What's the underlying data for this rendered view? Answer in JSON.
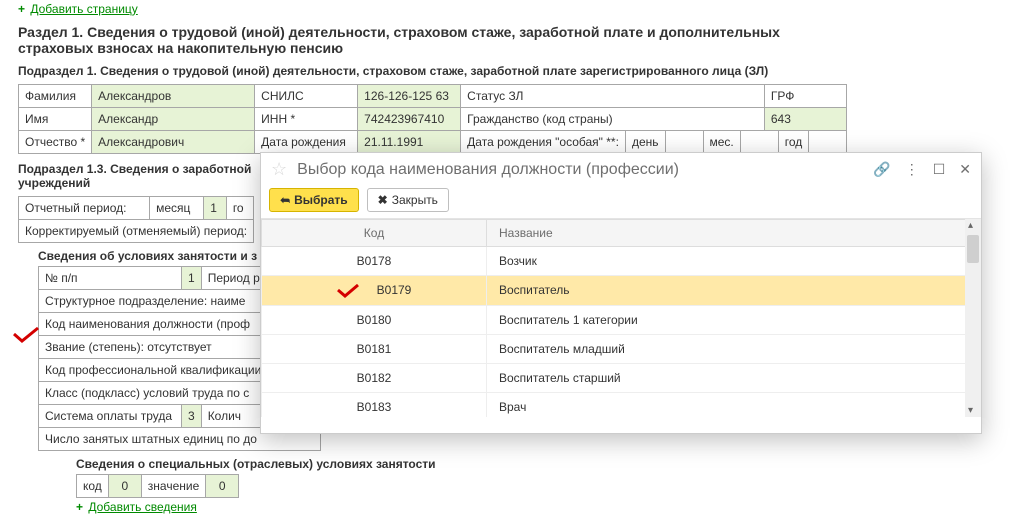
{
  "top_link": {
    "plus": "+",
    "label": "Добавить страницу"
  },
  "section_title": "Раздел 1. Сведения о трудовой (иной) деятельности, страховом стаже, заработной плате и дополнительных страховых взносах на накопительную пенсию",
  "sub1_title": "Подраздел 1. Сведения о трудовой (иной) деятельности, страховом стаже, заработной плате зарегистрированного лица (ЗЛ)",
  "table1": {
    "fam_lbl": "Фамилия",
    "fam_val": "Александров",
    "snils_lbl": "СНИЛС",
    "snils_val": "126-126-125 63",
    "status_lbl": "Статус ЗЛ",
    "grf_lbl": "ГРФ",
    "name_lbl": "Имя",
    "name_val": "Александр",
    "inn_lbl": "ИНН *",
    "inn_val": "742423967410",
    "grazh_lbl": "Гражданство (код страны)",
    "grazh_val": "643",
    "otch_lbl": "Отчество *",
    "otch_val": "Александрович",
    "bdate_lbl": "Дата рождения",
    "bdate_val": "21.11.1991",
    "bdate2_lbl": "Дата рождения \"особая\" **:",
    "day": "день",
    "mon": "мес.",
    "year": "год"
  },
  "sub13_title": "Подраздел 1.3.  Сведения о заработной",
  "sub13_title2": "учреждений",
  "period_row": {
    "otch_lbl": "Отчетный период:",
    "mes_lbl": "месяц",
    "mes_val": "1",
    "god_cut": "го",
    "corr_lbl": "Корректируемый (отменяемый) период:"
  },
  "cond": {
    "title": "Сведения об условиях занятости и з",
    "npp_lbl": "№ п/п",
    "npp_val": "1",
    "period_lbl": "Период работы в о",
    "struct_lbl": "Структурное подразделение:   наиме",
    "kod_lbl": "Код наименования должности (проф",
    "zvan_lbl": "Звание (степень):   отсутствует",
    "profkv_lbl": "Код профессиональной квалификации",
    "klass_lbl": "Класс (подкласс) условий труда по с",
    "sys_lbl": "Система оплаты труда",
    "sys_val": "3",
    "kolich": "Колич",
    "shtat_lbl": "Число занятых штатных единиц по до"
  },
  "spec": {
    "title": "Сведения о специальных (отраслевых) условиях занятости",
    "kod_lbl": "код",
    "kod_val": "0",
    "zn_lbl": "значение",
    "zn_val": "0",
    "add_link": "Добавить сведения"
  },
  "modal": {
    "title": "Выбор кода наименования должности (профессии)",
    "btn_select": "Выбрать",
    "btn_close": "Закрыть",
    "col_code": "Код",
    "col_name": "Название",
    "rows": [
      {
        "code": "В0178",
        "name": "Возчик"
      },
      {
        "code": "В0179",
        "name": "Воспитатель"
      },
      {
        "code": "В0180",
        "name": "Воспитатель 1 категории"
      },
      {
        "code": "В0181",
        "name": "Воспитатель младший"
      },
      {
        "code": "В0182",
        "name": "Воспитатель старший"
      },
      {
        "code": "В0183",
        "name": "Врач"
      }
    ],
    "selected_index": 1,
    "icons": {
      "link": "🔗",
      "more": "⋮",
      "max": "☐",
      "close": "✕",
      "arrow": "➦",
      "x": "✖",
      "star": "☆"
    }
  }
}
